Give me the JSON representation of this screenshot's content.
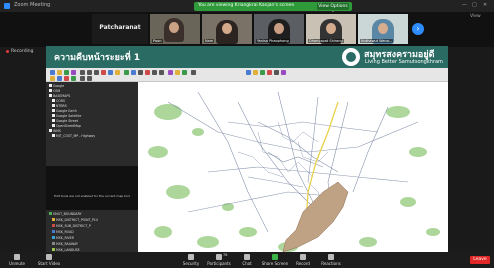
{
  "window": {
    "title": "Zoom Meeting",
    "share_banner": "You are viewing Kriangkrai Kanjan's screen",
    "view_options": "View Options ▾",
    "minimize": "—",
    "maximize": "□",
    "close": "✕"
  },
  "participants": {
    "active_name": "Patcharanat",
    "tiles": [
      {
        "label": "Poon"
      },
      {
        "label": "Nam"
      },
      {
        "label": "Yanisa Phaophong"
      },
      {
        "label": "Dhanyapat Shirong"
      },
      {
        "label": "Nuthawut Wana..."
      }
    ],
    "gallery_view": "View"
  },
  "recording": {
    "label": "Recording"
  },
  "shared_screen": {
    "header_title": "ความคืบหน้าระยะที่ 1",
    "brand_thai": "สมุทรสงครามอยู่ดี",
    "brand_en": "Living Better Samutsongkhram",
    "layers_panel": [
      "Google",
      "OSM",
      "BASEMAPS",
      "CORS",
      "NTBRS",
      "Google Earth",
      "Google Satellite",
      "Google Street",
      "OpenStreetMap",
      "WMS",
      "MIT_COST_MP - Highway"
    ],
    "mid_panel_message": "Edit tools are not enabled for the current map tool",
    "bottom_layers": [
      "SMUT_BOUNDARY",
      "MSK_DISTRICT_POINT_PLU",
      "MSK_SUB_DISTRICT_P",
      "MSK_ROAD",
      "MSK_RIVER",
      "MSK_RAILWAY",
      "MSK_LANDUSE",
      "MSK_NATIONAL_PARK"
    ]
  },
  "toolbar_bottom": {
    "items": [
      {
        "label": "Unmute"
      },
      {
        "label": "Start Video"
      },
      {
        "label": "Security"
      },
      {
        "label": "Participants"
      },
      {
        "label": "Chat"
      },
      {
        "label": "Share Screen"
      },
      {
        "label": "Record"
      },
      {
        "label": "Reactions"
      }
    ],
    "participant_count": "78",
    "leave": "Leave"
  },
  "colors": {
    "share_green": "#2e9a3a",
    "header_teal": "#2a6b63",
    "leave_red": "#e02828",
    "accent_blue": "#2d8cff"
  }
}
